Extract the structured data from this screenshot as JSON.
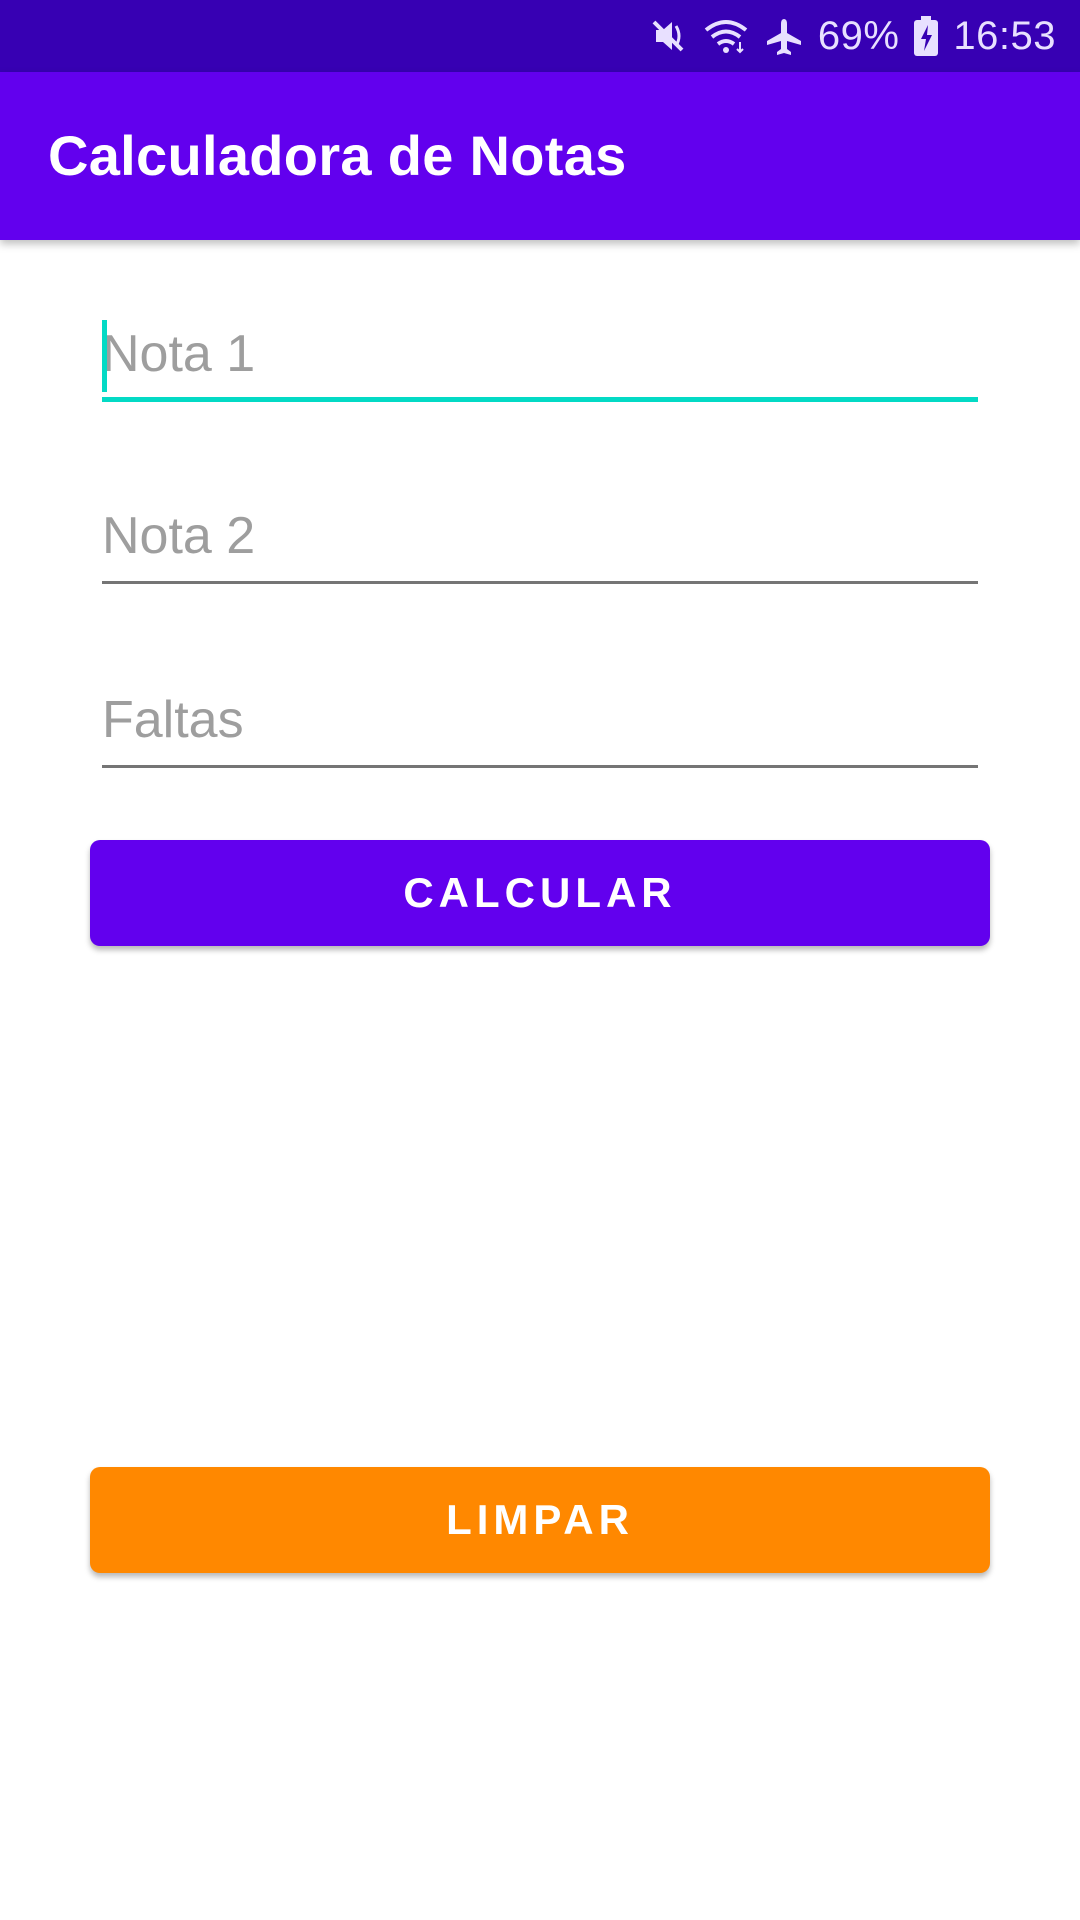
{
  "status_bar": {
    "battery": "69%",
    "time": "16:53",
    "icons": [
      "mute-icon",
      "wifi-icon",
      "airplane-icon",
      "battery-icon"
    ]
  },
  "app_bar": {
    "title": "Calculadora de Notas"
  },
  "form": {
    "nota1": {
      "placeholder": "Nota 1",
      "value": ""
    },
    "nota2": {
      "placeholder": "Nota 2",
      "value": ""
    },
    "faltas": {
      "placeholder": "Faltas",
      "value": ""
    }
  },
  "buttons": {
    "calcular": "CALCULAR",
    "limpar": "LIMPAR"
  },
  "colors": {
    "primary": "#6200EE",
    "primary_dark": "#3700B3",
    "accent": "#03DAC5",
    "limpar": "#FF8800"
  }
}
